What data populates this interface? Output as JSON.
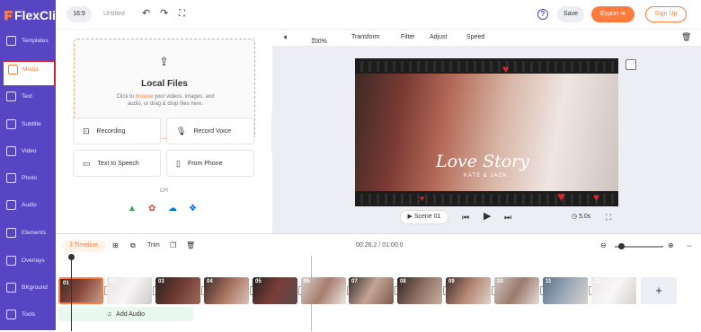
{
  "app": {
    "logo": "FlexClip",
    "title": "Untitled",
    "ratio": "16:9"
  },
  "sidebar": {
    "items": [
      {
        "label": "Templates",
        "icon": "templates-icon"
      },
      {
        "label": "Media",
        "icon": "media-icon",
        "active": true
      },
      {
        "label": "Text",
        "icon": "text-icon"
      },
      {
        "label": "Subtitle",
        "icon": "subtitle-icon"
      },
      {
        "label": "Video",
        "icon": "video-icon"
      },
      {
        "label": "Photo",
        "icon": "photo-icon"
      },
      {
        "label": "Audio",
        "icon": "audio-icon"
      },
      {
        "label": "Elements",
        "icon": "elements-icon"
      },
      {
        "label": "Overlays",
        "icon": "overlays-icon"
      },
      {
        "label": "BKground",
        "icon": "background-icon"
      },
      {
        "label": "Tools",
        "icon": "tools-icon"
      }
    ]
  },
  "topbar": {
    "save": "Save",
    "export": "Export",
    "signup": "Sign Up",
    "help": "?"
  },
  "media": {
    "upload_title": "Local Files",
    "hint_pre": "Click to ",
    "hint_link": "browse",
    "hint_post": " your videos, images, and audio, or drag & drop files here.",
    "recording": "Recording",
    "record_voice": "Record Voice",
    "text_to_speech": "Text to Speech",
    "from_phone": "From Phone",
    "or": "OR"
  },
  "preview_toolbar": {
    "zoom": "100%",
    "transform": "Transform",
    "filter": "Filter",
    "adjust": "Adjust",
    "speed": "Speed"
  },
  "video": {
    "title": "Love Story",
    "subtitle": "KATE & JACK"
  },
  "controls": {
    "scene": "Scene 01",
    "duration": "5.0s"
  },
  "timeline": {
    "tab": "Timeline",
    "trim": "Trim",
    "time": "00:26.2 / 01:00.0",
    "add_audio": "Add Audio",
    "clips": [
      "01",
      "02",
      "03",
      "04",
      "05",
      "06",
      "07",
      "08",
      "09",
      "10",
      "11",
      "12"
    ]
  },
  "colors": {
    "brand": "#5845c4",
    "accent": "#ff7a3d",
    "heart": "#d8262f"
  }
}
